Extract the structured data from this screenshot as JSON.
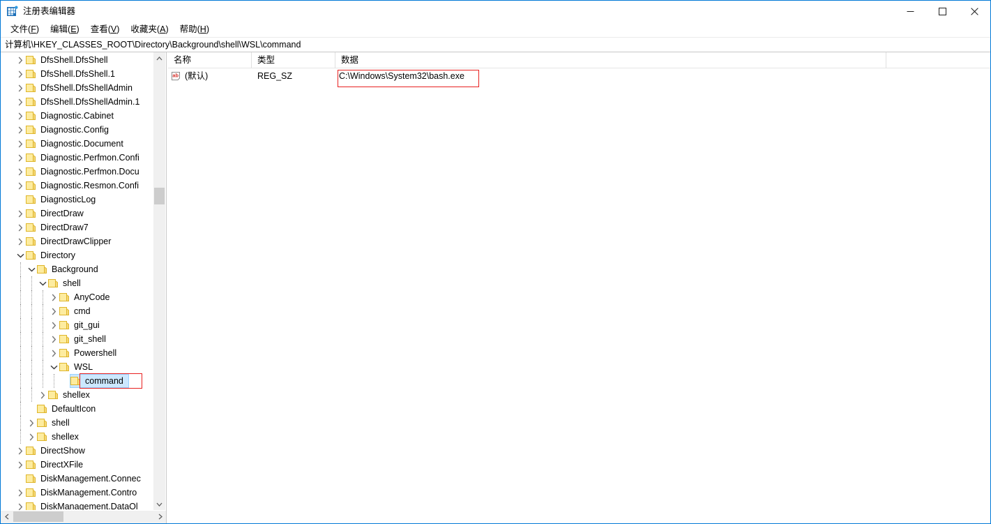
{
  "window": {
    "title": "注册表编辑器",
    "icon": "registry-icon",
    "accent": "#0078d7",
    "controls": {
      "minimize": "minimize-icon",
      "maximize": "maximize-icon",
      "close": "close-icon"
    }
  },
  "menubar": {
    "items": [
      {
        "label": "文件",
        "mnemonic": "F"
      },
      {
        "label": "编辑",
        "mnemonic": "E"
      },
      {
        "label": "查看",
        "mnemonic": "V"
      },
      {
        "label": "收藏夹",
        "mnemonic": "A"
      },
      {
        "label": "帮助",
        "mnemonic": "H"
      }
    ]
  },
  "address": {
    "path": "计算机\\HKEY_CLASSES_ROOT\\Directory\\Background\\shell\\WSL\\command"
  },
  "tree": {
    "items": [
      {
        "label": "DfsShell.DfsShell",
        "depth": 1,
        "expander": "collapsed"
      },
      {
        "label": "DfsShell.DfsShell.1",
        "depth": 1,
        "expander": "collapsed"
      },
      {
        "label": "DfsShell.DfsShellAdmin",
        "depth": 1,
        "expander": "collapsed"
      },
      {
        "label": "DfsShell.DfsShellAdmin.1",
        "depth": 1,
        "expander": "collapsed"
      },
      {
        "label": "Diagnostic.Cabinet",
        "depth": 1,
        "expander": "collapsed"
      },
      {
        "label": "Diagnostic.Config",
        "depth": 1,
        "expander": "collapsed"
      },
      {
        "label": "Diagnostic.Document",
        "depth": 1,
        "expander": "collapsed"
      },
      {
        "label": "Diagnostic.Perfmon.Confi",
        "depth": 1,
        "expander": "collapsed"
      },
      {
        "label": "Diagnostic.Perfmon.Docu",
        "depth": 1,
        "expander": "collapsed"
      },
      {
        "label": "Diagnostic.Resmon.Confi",
        "depth": 1,
        "expander": "collapsed"
      },
      {
        "label": "DiagnosticLog",
        "depth": 1,
        "expander": "none"
      },
      {
        "label": "DirectDraw",
        "depth": 1,
        "expander": "collapsed"
      },
      {
        "label": "DirectDraw7",
        "depth": 1,
        "expander": "collapsed"
      },
      {
        "label": "DirectDrawClipper",
        "depth": 1,
        "expander": "collapsed"
      },
      {
        "label": "Directory",
        "depth": 1,
        "expander": "expanded"
      },
      {
        "label": "Background",
        "depth": 2,
        "expander": "expanded"
      },
      {
        "label": "shell",
        "depth": 3,
        "expander": "expanded"
      },
      {
        "label": "AnyCode",
        "depth": 4,
        "expander": "collapsed"
      },
      {
        "label": "cmd",
        "depth": 4,
        "expander": "collapsed"
      },
      {
        "label": "git_gui",
        "depth": 4,
        "expander": "collapsed"
      },
      {
        "label": "git_shell",
        "depth": 4,
        "expander": "collapsed"
      },
      {
        "label": "Powershell",
        "depth": 4,
        "expander": "collapsed"
      },
      {
        "label": "WSL",
        "depth": 4,
        "expander": "expanded"
      },
      {
        "label": "command",
        "depth": 5,
        "expander": "none",
        "selected": true,
        "annotated": true
      },
      {
        "label": "shellex",
        "depth": 3,
        "expander": "collapsed"
      },
      {
        "label": "DefaultIcon",
        "depth": 2,
        "expander": "none"
      },
      {
        "label": "shell",
        "depth": 2,
        "expander": "collapsed"
      },
      {
        "label": "shellex",
        "depth": 2,
        "expander": "collapsed"
      },
      {
        "label": "DirectShow",
        "depth": 1,
        "expander": "collapsed"
      },
      {
        "label": "DirectXFile",
        "depth": 1,
        "expander": "collapsed"
      },
      {
        "label": "DiskManagement.Connec",
        "depth": 1,
        "expander": "none"
      },
      {
        "label": "DiskManagement.Contro",
        "depth": 1,
        "expander": "collapsed"
      },
      {
        "label": "DiskManagement.DataOl",
        "depth": 1,
        "expander": "collapsed"
      }
    ],
    "scrollbars": {
      "vertical_up": "scroll-up-icon",
      "vertical_down": "scroll-down-icon",
      "horizontal_left": "scroll-left-icon",
      "horizontal_right": "scroll-right-icon"
    }
  },
  "list": {
    "columns": [
      "名称",
      "类型",
      "数据"
    ],
    "rows": [
      {
        "icon": "string-value-icon",
        "name": "(默认)",
        "type": "REG_SZ",
        "data": "C:\\Windows\\System32\\bash.exe",
        "annotated": true
      }
    ]
  },
  "annotations": {
    "color": "#e8201f",
    "boxes": [
      "value-data-highlight",
      "tree-command-highlight"
    ]
  }
}
